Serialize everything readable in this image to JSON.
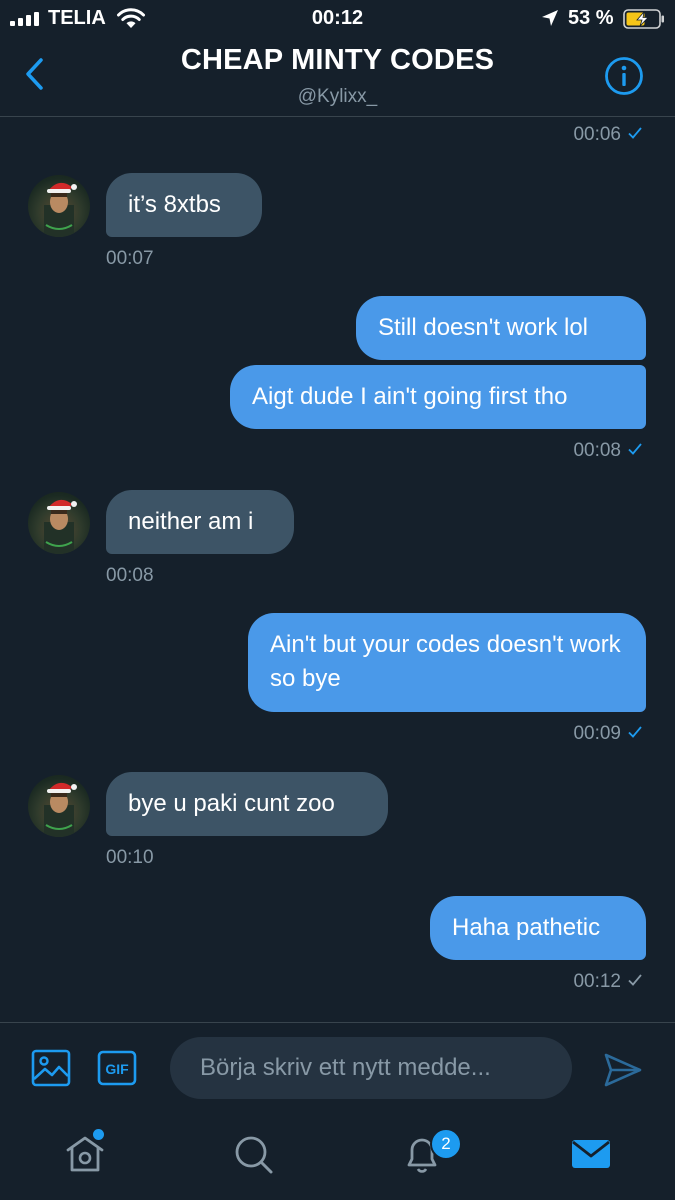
{
  "status_bar": {
    "carrier": "TELIA",
    "time": "00:12",
    "battery": "53 %"
  },
  "header": {
    "title": "CHEAP MINTY CODES",
    "handle": "@Kylixx_"
  },
  "messages": {
    "m0": {
      "time": "00:06"
    },
    "m1": {
      "text": "it’s 8xtbs",
      "time": "00:07"
    },
    "m2": {
      "text": "Still doesn't work lol"
    },
    "m3": {
      "text": "Aigt dude I ain't going first tho",
      "time": "00:08"
    },
    "m4": {
      "text": "neither am i",
      "time": "00:08"
    },
    "m5": {
      "text": "Ain't but your codes doesn't work so bye",
      "time": "00:09"
    },
    "m6": {
      "text": "bye u paki cunt zoo",
      "time": "00:10"
    },
    "m7": {
      "text": "Haha pathetic",
      "time": "00:12"
    }
  },
  "composer": {
    "placeholder": "Börja skriv ett nytt medde...",
    "gif_label": "GIF"
  },
  "tabbar": {
    "notifications_badge": "2"
  },
  "colors": {
    "background": "#15202b",
    "incoming_bubble": "#3d5466",
    "outgoing_bubble": "#4a99e9",
    "accent": "#1d9bf0",
    "muted": "#8899a6"
  },
  "icons": [
    "signal-icon",
    "wifi-icon",
    "location-icon",
    "battery-charging-icon",
    "back-chevron-icon",
    "info-icon",
    "image-icon",
    "gif-icon",
    "send-icon",
    "home-icon",
    "search-icon",
    "notifications-bell-icon",
    "messages-envelope-icon",
    "read-check-icon"
  ]
}
